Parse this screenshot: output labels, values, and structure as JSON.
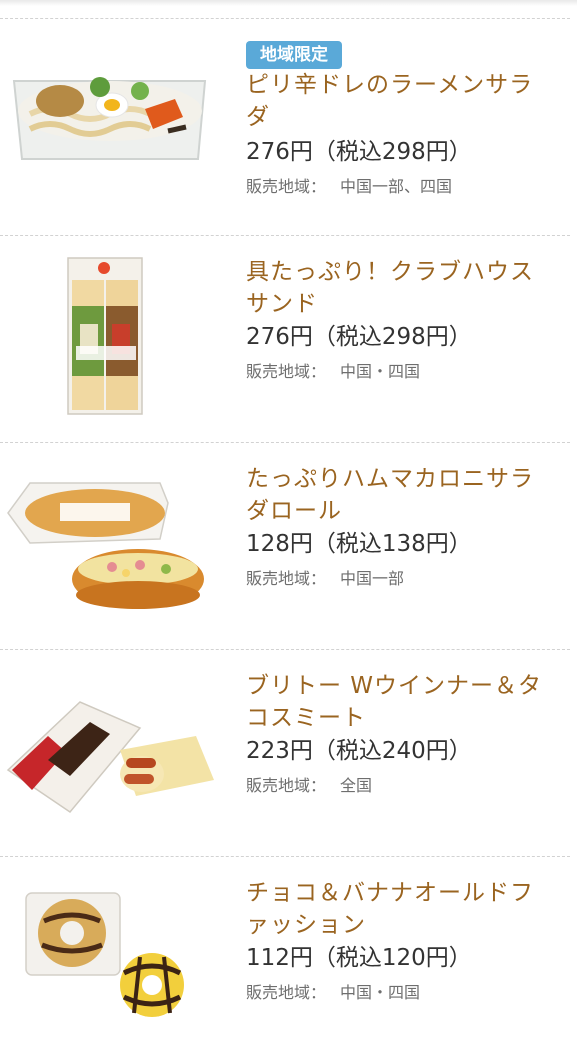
{
  "items": [
    {
      "badge": "地域限定",
      "name": "ピリ辛ドレのラーメンサラダ",
      "price": "276円（税込298円）",
      "area_label": "販売地域：",
      "area_value": "中国一部、四国",
      "image_icon": "ramen-salad-photo"
    },
    {
      "name": "具たっぷり！クラブハウスサンド",
      "price": "276円（税込298円）",
      "area_label": "販売地域：",
      "area_value": "中国・四国",
      "image_icon": "club-sandwich-photo"
    },
    {
      "name": "たっぷりハムマカロニサラダロール",
      "price": "128円（税込138円）",
      "area_label": "販売地域：",
      "area_value": "中国一部",
      "image_icon": "macaroni-roll-photo"
    },
    {
      "name": "ブリトー Wウインナー＆タコスミート",
      "price": "223円（税込240円）",
      "area_label": "販売地域：",
      "area_value": "全国",
      "image_icon": "burrito-photo"
    },
    {
      "name": "チョコ＆バナナオールドファッション",
      "price": "112円（税込120円）",
      "area_label": "販売地域：",
      "area_value": "中国・四国",
      "image_icon": "donut-photo"
    }
  ],
  "colors": {
    "name": "#9a6420",
    "price": "#333333",
    "area": "#6e6e6e",
    "badge": "#5aa9d8"
  }
}
